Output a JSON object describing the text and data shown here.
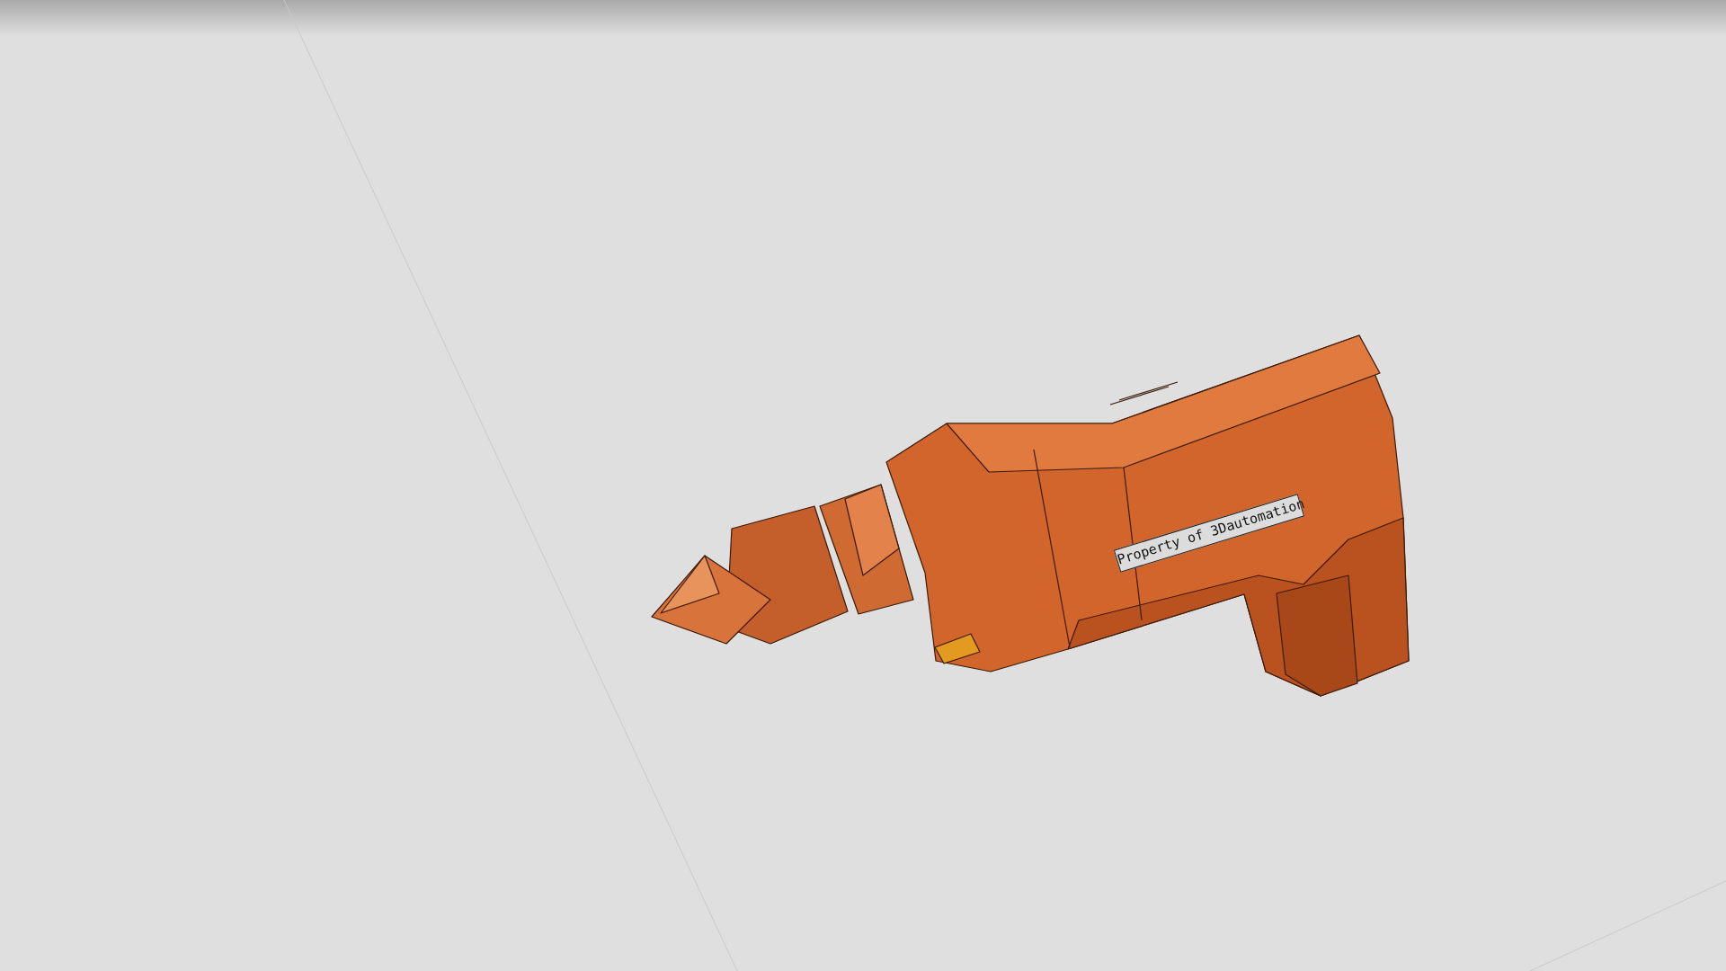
{
  "viewer": {
    "model_label": "Property of 3Dautomation"
  }
}
